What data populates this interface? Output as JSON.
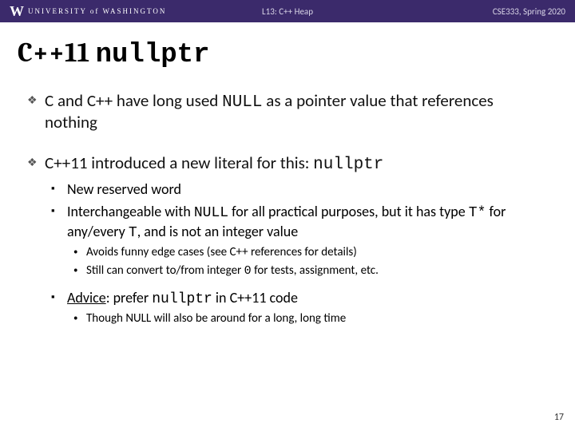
{
  "header": {
    "logo_w": "W",
    "logo_text": "UNIVERSITY of WASHINGTON",
    "center": "L13:  C++ Heap",
    "right": "CSE333, Spring 2020"
  },
  "title": {
    "plain": "C++11 ",
    "code": "nullptr"
  },
  "bullets": [
    {
      "parts": [
        {
          "t": "C and C++ have long used "
        },
        {
          "t": "NULL",
          "code": true
        },
        {
          "t": " as a pointer value that references nothing"
        }
      ]
    },
    {
      "parts": [
        {
          "t": "C++11 introduced a new literal for this: "
        },
        {
          "t": "nullptr",
          "code": true
        }
      ],
      "sub": [
        {
          "parts": [
            {
              "t": "New reserved word"
            }
          ]
        },
        {
          "parts": [
            {
              "t": "Interchangeable with "
            },
            {
              "t": "NULL",
              "code": true
            },
            {
              "t": " for all practical purposes, but it has type "
            },
            {
              "t": "T*",
              "code": true
            },
            {
              "t": " for any/every "
            },
            {
              "t": "T",
              "code": true
            },
            {
              "t": ", and is not an integer value"
            }
          ],
          "sub": [
            {
              "parts": [
                {
                  "t": "Avoids funny edge cases (see C++ references for details)"
                }
              ]
            },
            {
              "parts": [
                {
                  "t": "Still can convert to/from integer "
                },
                {
                  "t": "0",
                  "code": true
                },
                {
                  "t": " for tests, assignment, etc."
                }
              ]
            }
          ]
        },
        {
          "gap": true,
          "parts": [
            {
              "t": "Advice",
              "underline": true
            },
            {
              "t": ": prefer "
            },
            {
              "t": "nullptr",
              "code": true
            },
            {
              "t": " in C++11 code"
            }
          ],
          "sub": [
            {
              "parts": [
                {
                  "t": "Though NULL will also be around for a long, long time"
                }
              ]
            }
          ]
        }
      ]
    }
  ],
  "page_number": "17"
}
